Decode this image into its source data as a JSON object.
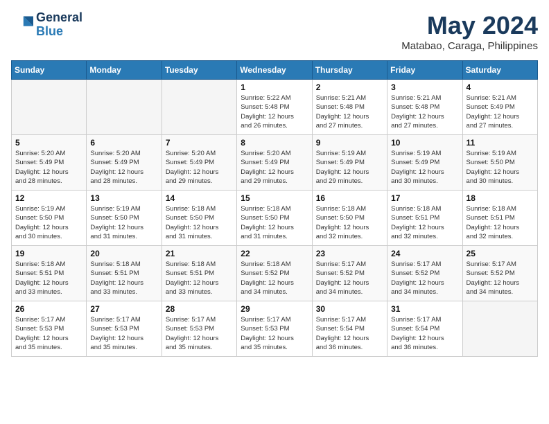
{
  "header": {
    "logo_line1": "General",
    "logo_line2": "Blue",
    "month": "May 2024",
    "location": "Matabao, Caraga, Philippines"
  },
  "days_of_week": [
    "Sunday",
    "Monday",
    "Tuesday",
    "Wednesday",
    "Thursday",
    "Friday",
    "Saturday"
  ],
  "weeks": [
    [
      {
        "day": "",
        "info": ""
      },
      {
        "day": "",
        "info": ""
      },
      {
        "day": "",
        "info": ""
      },
      {
        "day": "1",
        "info": "Sunrise: 5:22 AM\nSunset: 5:48 PM\nDaylight: 12 hours\nand 26 minutes."
      },
      {
        "day": "2",
        "info": "Sunrise: 5:21 AM\nSunset: 5:48 PM\nDaylight: 12 hours\nand 27 minutes."
      },
      {
        "day": "3",
        "info": "Sunrise: 5:21 AM\nSunset: 5:48 PM\nDaylight: 12 hours\nand 27 minutes."
      },
      {
        "day": "4",
        "info": "Sunrise: 5:21 AM\nSunset: 5:49 PM\nDaylight: 12 hours\nand 27 minutes."
      }
    ],
    [
      {
        "day": "5",
        "info": "Sunrise: 5:20 AM\nSunset: 5:49 PM\nDaylight: 12 hours\nand 28 minutes."
      },
      {
        "day": "6",
        "info": "Sunrise: 5:20 AM\nSunset: 5:49 PM\nDaylight: 12 hours\nand 28 minutes."
      },
      {
        "day": "7",
        "info": "Sunrise: 5:20 AM\nSunset: 5:49 PM\nDaylight: 12 hours\nand 29 minutes."
      },
      {
        "day": "8",
        "info": "Sunrise: 5:20 AM\nSunset: 5:49 PM\nDaylight: 12 hours\nand 29 minutes."
      },
      {
        "day": "9",
        "info": "Sunrise: 5:19 AM\nSunset: 5:49 PM\nDaylight: 12 hours\nand 29 minutes."
      },
      {
        "day": "10",
        "info": "Sunrise: 5:19 AM\nSunset: 5:49 PM\nDaylight: 12 hours\nand 30 minutes."
      },
      {
        "day": "11",
        "info": "Sunrise: 5:19 AM\nSunset: 5:50 PM\nDaylight: 12 hours\nand 30 minutes."
      }
    ],
    [
      {
        "day": "12",
        "info": "Sunrise: 5:19 AM\nSunset: 5:50 PM\nDaylight: 12 hours\nand 30 minutes."
      },
      {
        "day": "13",
        "info": "Sunrise: 5:19 AM\nSunset: 5:50 PM\nDaylight: 12 hours\nand 31 minutes."
      },
      {
        "day": "14",
        "info": "Sunrise: 5:18 AM\nSunset: 5:50 PM\nDaylight: 12 hours\nand 31 minutes."
      },
      {
        "day": "15",
        "info": "Sunrise: 5:18 AM\nSunset: 5:50 PM\nDaylight: 12 hours\nand 31 minutes."
      },
      {
        "day": "16",
        "info": "Sunrise: 5:18 AM\nSunset: 5:50 PM\nDaylight: 12 hours\nand 32 minutes."
      },
      {
        "day": "17",
        "info": "Sunrise: 5:18 AM\nSunset: 5:51 PM\nDaylight: 12 hours\nand 32 minutes."
      },
      {
        "day": "18",
        "info": "Sunrise: 5:18 AM\nSunset: 5:51 PM\nDaylight: 12 hours\nand 32 minutes."
      }
    ],
    [
      {
        "day": "19",
        "info": "Sunrise: 5:18 AM\nSunset: 5:51 PM\nDaylight: 12 hours\nand 33 minutes."
      },
      {
        "day": "20",
        "info": "Sunrise: 5:18 AM\nSunset: 5:51 PM\nDaylight: 12 hours\nand 33 minutes."
      },
      {
        "day": "21",
        "info": "Sunrise: 5:18 AM\nSunset: 5:51 PM\nDaylight: 12 hours\nand 33 minutes."
      },
      {
        "day": "22",
        "info": "Sunrise: 5:18 AM\nSunset: 5:52 PM\nDaylight: 12 hours\nand 34 minutes."
      },
      {
        "day": "23",
        "info": "Sunrise: 5:17 AM\nSunset: 5:52 PM\nDaylight: 12 hours\nand 34 minutes."
      },
      {
        "day": "24",
        "info": "Sunrise: 5:17 AM\nSunset: 5:52 PM\nDaylight: 12 hours\nand 34 minutes."
      },
      {
        "day": "25",
        "info": "Sunrise: 5:17 AM\nSunset: 5:52 PM\nDaylight: 12 hours\nand 34 minutes."
      }
    ],
    [
      {
        "day": "26",
        "info": "Sunrise: 5:17 AM\nSunset: 5:53 PM\nDaylight: 12 hours\nand 35 minutes."
      },
      {
        "day": "27",
        "info": "Sunrise: 5:17 AM\nSunset: 5:53 PM\nDaylight: 12 hours\nand 35 minutes."
      },
      {
        "day": "28",
        "info": "Sunrise: 5:17 AM\nSunset: 5:53 PM\nDaylight: 12 hours\nand 35 minutes."
      },
      {
        "day": "29",
        "info": "Sunrise: 5:17 AM\nSunset: 5:53 PM\nDaylight: 12 hours\nand 35 minutes."
      },
      {
        "day": "30",
        "info": "Sunrise: 5:17 AM\nSunset: 5:54 PM\nDaylight: 12 hours\nand 36 minutes."
      },
      {
        "day": "31",
        "info": "Sunrise: 5:17 AM\nSunset: 5:54 PM\nDaylight: 12 hours\nand 36 minutes."
      },
      {
        "day": "",
        "info": ""
      }
    ]
  ]
}
